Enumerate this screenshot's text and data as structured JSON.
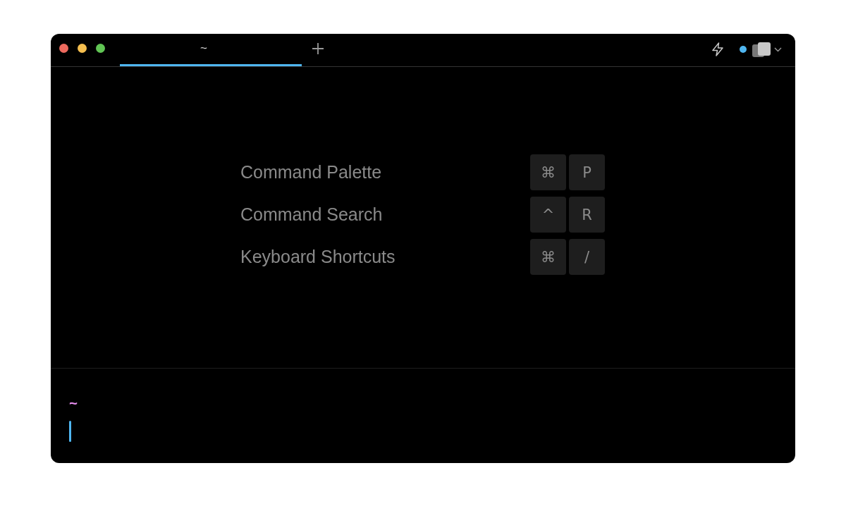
{
  "tabs": [
    {
      "label": "~",
      "selected": true
    }
  ],
  "shortcuts": [
    {
      "label": "Command Palette",
      "keys": [
        "⌘",
        "P"
      ]
    },
    {
      "label": "Command Search",
      "keys": [
        "^",
        "R"
      ]
    },
    {
      "label": "Keyboard Shortcuts",
      "keys": [
        "⌘",
        "/"
      ]
    }
  ],
  "prompt": {
    "path": "~"
  }
}
